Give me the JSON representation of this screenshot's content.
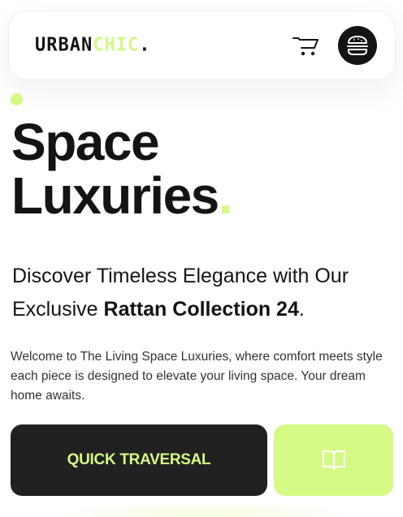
{
  "header": {
    "logo": {
      "part1": "URBAN",
      "part2": "CHIC",
      "part3": "."
    },
    "cart_icon": "cart-icon",
    "menu_icon": "burger-icon"
  },
  "hero": {
    "title_line1": "Space",
    "title_line2": "Luxuries",
    "title_dot": "."
  },
  "subtitle": {
    "text_before": "Discover Timeless Elegance with Our Exclusive ",
    "bold": "Rattan Collection 24",
    "text_after": "."
  },
  "description": "Welcome to The Living Space Luxuries, where comfort meets style each piece is designed to elevate your living space. Your dream home awaits.",
  "actions": {
    "primary_label": "QUICK TRAVERSAL",
    "secondary_icon": "book-icon"
  },
  "colors": {
    "accent": "#d5f985",
    "dark": "#141414",
    "button_dark": "#212121"
  }
}
